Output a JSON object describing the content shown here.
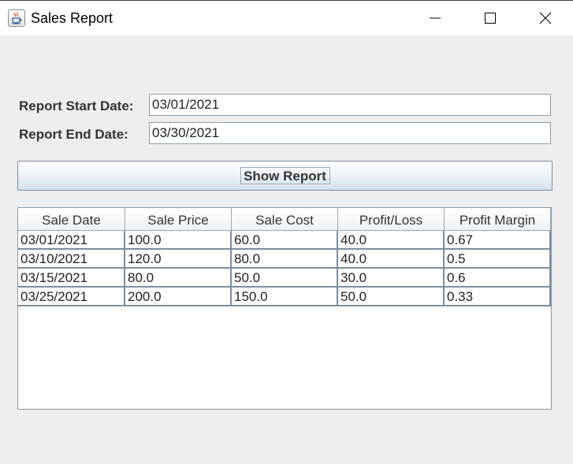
{
  "window": {
    "title": "Sales Report",
    "icon": "java-cup-icon",
    "controls": [
      "minimize-icon",
      "maximize-icon",
      "close-icon"
    ]
  },
  "form": {
    "start_label": "Report Start Date:",
    "start_value": "03/01/2021",
    "end_label": "Report End Date:",
    "end_value": "03/30/2021",
    "button_label": "Show Report"
  },
  "table": {
    "columns": [
      "Sale Date",
      "Sale Price",
      "Sale Cost",
      "Profit/Loss",
      "Profit Margin"
    ],
    "rows": [
      [
        "03/01/2021",
        "100.0",
        "60.0",
        "40.0",
        "0.67"
      ],
      [
        "03/10/2021",
        "120.0",
        "80.0",
        "40.0",
        "0.5"
      ],
      [
        "03/15/2021",
        "80.0",
        "50.0",
        "30.0",
        "0.6"
      ],
      [
        "03/25/2021",
        "200.0",
        "150.0",
        "50.0",
        "0.33"
      ]
    ]
  },
  "colors": {
    "window_background": "#eeeeee",
    "button_gradient_bottom": "#d4e1ee",
    "grid_lines": "#7d8e9a"
  }
}
